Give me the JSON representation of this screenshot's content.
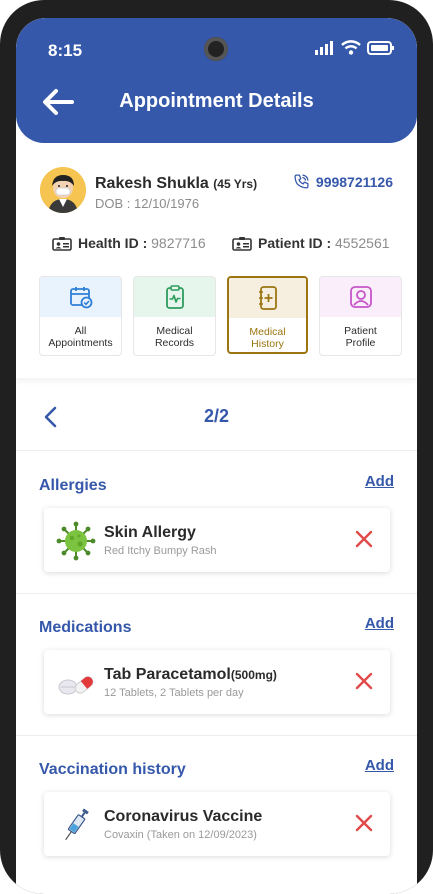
{
  "status_bar": {
    "time": "8:15"
  },
  "header": {
    "title": "Appointment Details"
  },
  "patient": {
    "name": "Rakesh Shukla",
    "age": "(45 Yrs)",
    "dob": "DOB : 12/10/1976",
    "phone": "9998721126",
    "health_id_label": "Health ID :",
    "health_id": "9827716",
    "patient_id_label": "Patient ID :",
    "patient_id": "4552561"
  },
  "tiles": [
    {
      "line1": "All",
      "line2": "Appointments",
      "icon": "calendar-check-icon",
      "color": "#2f7fd6",
      "bg": "#e9f3fd"
    },
    {
      "line1": "Medical",
      "line2": "Records",
      "icon": "clipboard-pulse-icon",
      "color": "#2e9c5e",
      "bg": "#e7f6ec"
    },
    {
      "line1": "Medical",
      "line2": "History",
      "icon": "medical-book-icon",
      "color": "#9a7510",
      "bg": "#f6efdf"
    },
    {
      "line1": "Patient",
      "line2": "Profile",
      "icon": "user-profile-icon",
      "color": "#c655c9",
      "bg": "#f9eefa"
    }
  ],
  "pager": {
    "text": "2/2"
  },
  "sections": {
    "allergies": {
      "title": "Allergies",
      "add": "Add",
      "item": {
        "name": "Skin Allergy",
        "detail": "Red Itchy Bumpy Rash",
        "icon": "virus-icon"
      }
    },
    "medications": {
      "title": "Medications",
      "add": "Add",
      "item": {
        "name": "Tab Paracetamol",
        "dose": "(500mg)",
        "detail": "12 Tablets, 2 Tablets per day",
        "icon": "pills-icon"
      }
    },
    "vaccination": {
      "title": "Vaccination history",
      "add": "Add",
      "item": {
        "name": "Coronavirus Vaccine",
        "detail": "Covaxin (Taken on 12/09/2023)",
        "icon": "syringe-icon"
      }
    }
  },
  "colors": {
    "primary": "#3558aa",
    "accent": "#9a7510",
    "delete": "#e04a4a"
  }
}
